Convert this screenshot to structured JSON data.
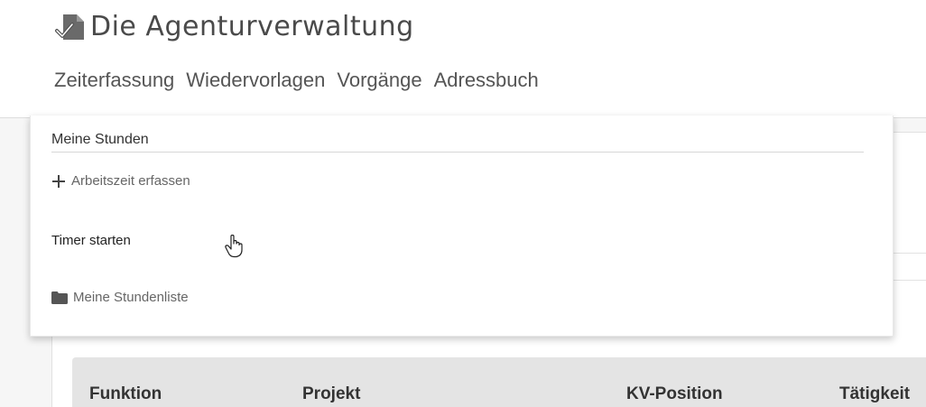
{
  "app": {
    "title": "Die Agenturverwaltung"
  },
  "nav": {
    "items": [
      {
        "label": "Zeiterfassung"
      },
      {
        "label": "Wiedervorlagen"
      },
      {
        "label": "Vorgänge"
      },
      {
        "label": "Adressbuch"
      }
    ]
  },
  "dropdown": {
    "header": "Meine Stunden",
    "items": [
      {
        "label": "Arbeitszeit erfassen",
        "icon": "plus-icon"
      },
      {
        "label": "Timer starten",
        "icon": ""
      },
      {
        "label": "Meine Stundenliste",
        "icon": "folder-icon"
      }
    ]
  },
  "table": {
    "columns": [
      {
        "label": "Funktion"
      },
      {
        "label": "Projekt"
      },
      {
        "label": "KV-Position"
      },
      {
        "label": "Tätigkeit"
      }
    ]
  },
  "colors": {
    "header_bg": "#e4e4e4",
    "text": "#333333",
    "nav_text": "#555555",
    "muted_text": "#666666"
  }
}
